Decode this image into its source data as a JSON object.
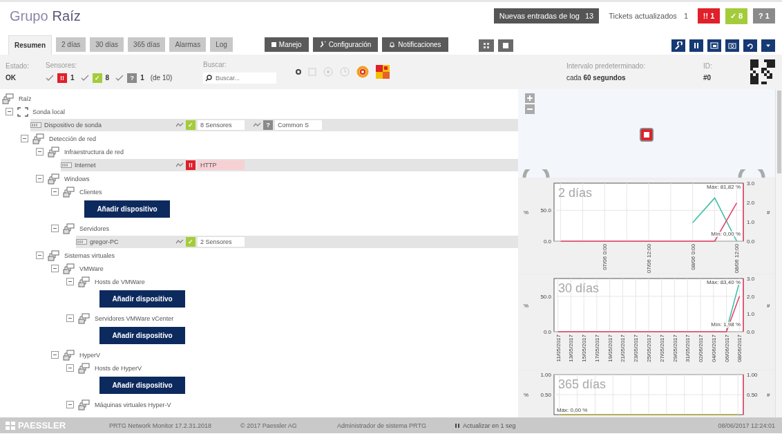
{
  "header": {
    "title_prefix": "Grupo",
    "title": "Raíz",
    "log_button": {
      "label": "Nuevas entradas de log",
      "count": "13"
    },
    "tickets": {
      "label": "Tickets actualizados",
      "count": "1"
    },
    "status_badges": [
      {
        "color": "#e0202a",
        "glyph": "!!",
        "count": "1"
      },
      {
        "color": "#a4cc3a",
        "glyph": "✓",
        "count": "8"
      },
      {
        "color": "#8a8a8a",
        "glyph": "?",
        "count": "1"
      }
    ]
  },
  "tabs": [
    {
      "label": "Resumen",
      "selected": true
    },
    {
      "label": "2 días",
      "selected": false
    },
    {
      "label": "30 días",
      "selected": false
    },
    {
      "label": "365 días",
      "selected": false
    },
    {
      "label": "Alarmas",
      "selected": false
    },
    {
      "label": "Log",
      "selected": false
    }
  ],
  "action_buttons": [
    {
      "kind": "manage",
      "label": "Manejo"
    },
    {
      "kind": "settings",
      "label": "Configuración"
    },
    {
      "kind": "notifications",
      "label": "Notificaciones"
    }
  ],
  "info": {
    "status_label": "Estado:",
    "status": "OK",
    "sensors_label": "Sensores:",
    "sensor_filters": [
      {
        "color": "#e0202a",
        "glyph": "!!",
        "count": "1",
        "checked": true
      },
      {
        "color": "#a4cc3a",
        "glyph": "✓",
        "count": "8",
        "checked": true
      },
      {
        "color": "#8a8a8a",
        "glyph": "?",
        "count": "1",
        "checked": true
      }
    ],
    "sensor_total": "(de 10)",
    "search": {
      "label": "Buscar:",
      "placeholder": "Buscar..."
    },
    "interval_label": "Intervalo predeterminado:",
    "interval": "cada **60 segundos**",
    "id_label": "ID:",
    "id": "#0"
  },
  "tree": {
    "kind": "root",
    "name": "Raíz",
    "children": [
      {
        "kind": "probe",
        "name": "Sonda local",
        "expanded": true,
        "children": [
          {
            "kind": "device",
            "name": "Dispositivo de sonda",
            "sensors": [
              {
                "color": "#a4cc3a",
                "glyph": "✓",
                "label": "8 Sensores",
                "highlighted": false
              },
              {
                "color": "#8a8a8a",
                "glyph": "?",
                "label": "Common S",
                "highlighted": false
              }
            ]
          },
          {
            "kind": "group",
            "name": "Detección de red",
            "expanded": true,
            "children": [
              {
                "kind": "group",
                "name": "Infraestructura de red",
                "expanded": true,
                "children": [
                  {
                    "kind": "device",
                    "name": "Internet",
                    "sensors": [
                      {
                        "color": "#e0202a",
                        "glyph": "!!",
                        "label": "HTTP",
                        "highlighted": true
                      }
                    ]
                  }
                ]
              },
              {
                "kind": "group",
                "name": "Windows",
                "expanded": true,
                "children": [
                  {
                    "kind": "group",
                    "name": "Clientes",
                    "expanded": true,
                    "add_button": "Añadir dispositivo"
                  },
                  {
                    "kind": "group",
                    "name": "Servidores",
                    "expanded": true,
                    "children": [
                      {
                        "kind": "device",
                        "name": "gregor-PC",
                        "sensors": [
                          {
                            "color": "#a4cc3a",
                            "glyph": "✓",
                            "label": "2 Sensores",
                            "highlighted": false
                          }
                        ]
                      }
                    ]
                  }
                ]
              },
              {
                "kind": "group",
                "name": "Sistemas virtuales",
                "expanded": true,
                "children": [
                  {
                    "kind": "group",
                    "name": "VMWare",
                    "expanded": true,
                    "children": [
                      {
                        "kind": "group",
                        "name": "Hosts de VMWare",
                        "expanded": true,
                        "add_button": "Añadir dispositivo"
                      },
                      {
                        "kind": "group",
                        "name": "Servidores VMWare vCenter",
                        "expanded": true,
                        "add_button": "Añadir dispositivo"
                      }
                    ]
                  },
                  {
                    "kind": "group",
                    "name": "HyperV",
                    "expanded": true,
                    "children": [
                      {
                        "kind": "group",
                        "name": "Hosts de HyperV",
                        "expanded": true,
                        "add_button": "Añadir dispositivo"
                      },
                      {
                        "kind": "group",
                        "name": "Máquinas virtuales Hyper-V",
                        "expanded": true
                      }
                    ]
                  }
                ]
              }
            ]
          }
        ]
      }
    ]
  },
  "charts": [
    {
      "chart_data": {
        "type": "line",
        "title": "2 días",
        "ylabel": "%",
        "y2label": "#",
        "grid": true,
        "categories": [
          null,
          null,
          "07/06 0:00",
          null,
          "07/06 12:00",
          null,
          "08/06 0:00",
          null,
          "08/06 12:00"
        ],
        "ylim": [
          0,
          94
        ],
        "y2lim": [
          0,
          3
        ],
        "yticks": [
          {
            "value": 0,
            "label": "0.0"
          },
          {
            "value": 50,
            "label": "50.0"
          }
        ],
        "y2ticks": [
          {
            "value": 0,
            "label": "0.0"
          },
          {
            "value": 1,
            "label": "1.0"
          },
          {
            "value": 2,
            "label": "2.0"
          },
          {
            "value": 3,
            "label": "3.0"
          }
        ],
        "series": [
          {
            "color": "#3dbfa8",
            "values": [
              null,
              null,
              null,
              null,
              null,
              null,
              30,
              70,
              0
            ]
          },
          {
            "color": "#e8436a",
            "values": [
              0,
              0,
              0,
              0,
              0,
              0,
              0,
              0,
              62
            ]
          }
        ],
        "annotations": [
          "Máx: 81,82 %",
          "Mín: 0,00 %"
        ]
      }
    },
    {
      "chart_data": {
        "type": "line",
        "title": "30 días",
        "ylabel": "%",
        "y2label": "#",
        "grid": true,
        "categories": [
          "11/05/2017",
          "13/05/2017",
          "15/05/2017",
          "17/05/2017",
          "19/05/2017",
          "21/05/2017",
          "23/05/2017",
          "25/05/2017",
          "27/05/2017",
          "29/05/2017",
          "31/05/2017",
          "02/06/2017",
          "04/06/2017",
          "06/06/2017",
          "08/06/2017"
        ],
        "ylim": [
          0,
          75
        ],
        "y2lim": [
          0,
          3
        ],
        "yticks": [
          {
            "value": 0,
            "label": "0.0"
          },
          {
            "value": 50,
            "label": "50.0"
          }
        ],
        "y2ticks": [
          {
            "value": 0,
            "label": "0.0"
          },
          {
            "value": 1,
            "label": "1.0"
          },
          {
            "value": 2,
            "label": "2.0"
          },
          {
            "value": 3,
            "label": "3.0"
          }
        ],
        "series": [
          {
            "color": "#3dbfa8",
            "values": [
              null,
              null,
              null,
              null,
              null,
              null,
              null,
              null,
              null,
              null,
              null,
              null,
              null,
              2,
              70
            ]
          },
          {
            "color": "#e8436a",
            "values": [
              0,
              0,
              0,
              0,
              0,
              0,
              0,
              0,
              0,
              0,
              0,
              0,
              0,
              0,
              50
            ]
          }
        ],
        "annotations": [
          "Máx: 83,40 %",
          "Mín: 1,98 %"
        ]
      }
    },
    {
      "chart_data": {
        "type": "line",
        "title": "365 días",
        "ylabel": "%",
        "y2label": "#",
        "grid": true,
        "categories": [
          null,
          null,
          null,
          null,
          null,
          null,
          null,
          null,
          null,
          null,
          null
        ],
        "ylim": [
          0,
          1
        ],
        "y2lim": [
          0,
          1
        ],
        "yticks": [
          {
            "value": 0.5,
            "label": "0.50"
          },
          {
            "value": 1,
            "label": "1.00"
          }
        ],
        "y2ticks": [
          {
            "value": 0.5,
            "label": "0.50"
          },
          {
            "value": 1,
            "label": "1.00"
          }
        ],
        "series": [
          {
            "color": "#b8b040",
            "values": [
              0,
              0,
              0,
              0,
              0,
              0,
              0,
              0,
              0,
              0,
              0
            ]
          }
        ],
        "annotations": [
          "Máx: 0,00 %"
        ]
      }
    }
  ],
  "footer": {
    "logo": "PAESSLER",
    "version": "PRTG Network Monitor 17.2.31.2018",
    "copyright": "© 2017 Paessler AG",
    "user": "Administrador de sistema PRTG",
    "refresh": "Actualizar en 1 seg",
    "datetime": "08/06/2017 12:24:01"
  }
}
